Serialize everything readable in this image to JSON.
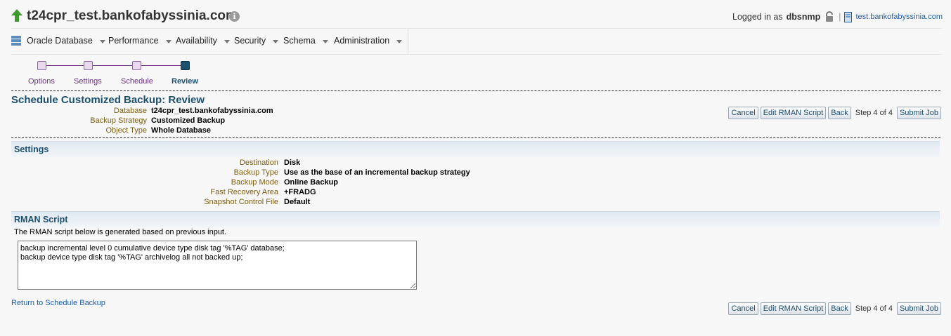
{
  "header": {
    "title": "t24cpr_test.bankofabyssinia.com",
    "info_glyph": "i",
    "logged_in_label": "Logged in as",
    "user": "dbsnmp",
    "host": "test.bankofabyssinia.com"
  },
  "menu": [
    {
      "label": "Oracle Database",
      "icon": "database-icon"
    },
    {
      "label": "Performance"
    },
    {
      "label": "Availability"
    },
    {
      "label": "Security"
    },
    {
      "label": "Schema"
    },
    {
      "label": "Administration"
    }
  ],
  "train": {
    "steps": [
      "Options",
      "Settings",
      "Schedule",
      "Review"
    ],
    "current": "Review"
  },
  "page": {
    "title": "Schedule Customized Backup: Review",
    "summary": [
      {
        "key": "Database",
        "value": "t24cpr_test.bankofabyssinia.com"
      },
      {
        "key": "Backup Strategy",
        "value": "Customized Backup"
      },
      {
        "key": "Object Type",
        "value": "Whole Database"
      }
    ]
  },
  "buttons": {
    "cancel": "Cancel",
    "edit_script": "Edit RMAN Script",
    "back": "Back",
    "step": "Step 4 of 4",
    "submit": "Submit Job"
  },
  "settings": {
    "title": "Settings",
    "rows": [
      {
        "key": "Destination",
        "value": "Disk"
      },
      {
        "key": "Backup Type",
        "value": "Use as the base of an incremental backup strategy"
      },
      {
        "key": "Backup Mode",
        "value": "Online Backup"
      },
      {
        "key": "Fast Recovery Area",
        "value": "+FRADG"
      },
      {
        "key": "Snapshot Control File",
        "value": "Default"
      }
    ]
  },
  "rman": {
    "title": "RMAN Script",
    "note": "The RMAN script below is generated based on previous input.",
    "script": "backup incremental level 0 cumulative device type disk tag '%TAG' database;\nbackup device type disk tag '%TAG' archivelog all not backed up;"
  },
  "footer": {
    "return_link": "Return to Schedule Backup"
  },
  "colors": {
    "accent": "#1d4f6e",
    "label": "#7d5e12",
    "train": "#6b2f80",
    "link": "#1f5fa8"
  }
}
